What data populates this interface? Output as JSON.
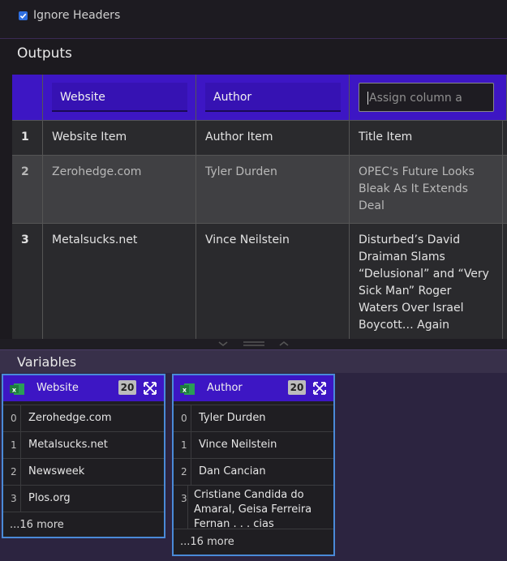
{
  "options": {
    "ignore_headers_label": "Ignore Headers",
    "ignore_headers_checked": true
  },
  "outputs": {
    "title": "Outputs",
    "columns": [
      {
        "name": "Website",
        "placeholder": ""
      },
      {
        "name": "Author",
        "placeholder": ""
      },
      {
        "name": "",
        "placeholder": "Assign column a name"
      }
    ],
    "rows": [
      {
        "index": "1",
        "cells": [
          "Website Item",
          "Author Item",
          "Title Item"
        ]
      },
      {
        "index": "2",
        "cells": [
          "Zerohedge.com",
          "Tyler Durden",
          "OPEC's Future Looks Bleak As It Extends Deal"
        ]
      },
      {
        "index": "3",
        "cells": [
          "Metalsucks.net",
          "Vince Neilstein",
          "Disturbed’s David Draiman Slams “Delusional” and “Very Sick Man” Roger Waters Over Israel Boycott… Again"
        ]
      }
    ]
  },
  "variables": {
    "title": "Variables",
    "cards": [
      {
        "name": "Website",
        "count": "20",
        "items": [
          {
            "index": "0",
            "value": "Zerohedge.com"
          },
          {
            "index": "1",
            "value": "Metalsucks.net"
          },
          {
            "index": "2",
            "value": "Newsweek"
          },
          {
            "index": "3",
            "value": "Plos.org"
          }
        ],
        "more": "...16 more"
      },
      {
        "name": "Author",
        "count": "20",
        "items": [
          {
            "index": "0",
            "value": "Tyler Durden"
          },
          {
            "index": "1",
            "value": "Vince Neilstein"
          },
          {
            "index": "2",
            "value": "Dan Cancian"
          },
          {
            "index": "3",
            "value": "Cristiane Candida do Amaral, Geisa Ferreira Fernan . . . cias Rodrigues, Eva Burger"
          }
        ],
        "more": "...16 more"
      }
    ]
  },
  "colors": {
    "accent": "#3d16c4",
    "checkbox": "#2f6fe0",
    "card_border": "#4a8ad8",
    "excel_green": "#1e7a3c"
  },
  "icons": {
    "excel": "excel-file-icon",
    "expand": "expand-arrows-icon"
  }
}
